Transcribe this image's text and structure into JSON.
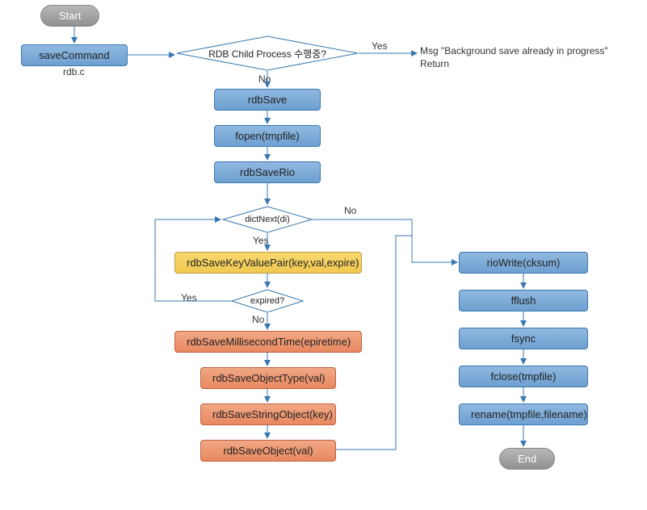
{
  "nodes": {
    "start": "Start",
    "saveCommand": "saveCommand",
    "saveCommand_sub": "rdb.c",
    "decision1": "RDB Child Process 수행중?",
    "msg_yes_line1": "Msg \"Background save already in progress\"",
    "msg_yes_line2": "Return",
    "rdbSave": "rdbSave",
    "fopen": "fopen(tmpfile)",
    "rdbSaveRio": "rdbSaveRio",
    "dictNext": "dictNext(di)",
    "rdbSaveKVP": "rdbSaveKeyValuePair(key,val,expire)",
    "expired": "expired?",
    "rdbSaveMs": "rdbSaveMillisecondTime(epiretime)",
    "rdbSaveObjType": "rdbSaveObjectType(val)",
    "rdbSaveStrObj": "rdbSaveStringObject(key)",
    "rdbSaveObj": "rdbSaveObject(val)",
    "rioWrite": "rioWrite(cksum)",
    "fflush": "fflush",
    "fsync": "fsync",
    "fclose": "fclose(tmpfile)",
    "rename": "rename(tmpfile,filename)",
    "end": "End"
  },
  "labels": {
    "yes1": "Yes",
    "no1": "No",
    "yes2": "Yes",
    "no2": "No",
    "yes3": "Yes",
    "no3": "No"
  },
  "chart_data": {
    "type": "flowchart",
    "title": "Redis SAVE command flow",
    "nodes": [
      {
        "id": "start",
        "type": "terminal",
        "label": "Start"
      },
      {
        "id": "saveCommand",
        "type": "process",
        "label": "saveCommand",
        "note": "rdb.c"
      },
      {
        "id": "d1",
        "type": "decision",
        "label": "RDB Child Process 수행중?"
      },
      {
        "id": "msg",
        "type": "annotation",
        "label": "Msg \"Background save already in progress\" Return"
      },
      {
        "id": "rdbSave",
        "type": "process",
        "label": "rdbSave"
      },
      {
        "id": "fopen",
        "type": "process",
        "label": "fopen(tmpfile)"
      },
      {
        "id": "rdbSaveRio",
        "type": "process",
        "label": "rdbSaveRio"
      },
      {
        "id": "d2",
        "type": "decision",
        "label": "dictNext(di)"
      },
      {
        "id": "rdbSaveKVP",
        "type": "process",
        "label": "rdbSaveKeyValuePair(key,val,expire)"
      },
      {
        "id": "d3",
        "type": "decision",
        "label": "expired?"
      },
      {
        "id": "rdbSaveMs",
        "type": "process",
        "label": "rdbSaveMillisecondTime(epiretime)"
      },
      {
        "id": "rdbSaveObjType",
        "type": "process",
        "label": "rdbSaveObjectType(val)"
      },
      {
        "id": "rdbSaveStrObj",
        "type": "process",
        "label": "rdbSaveStringObject(key)"
      },
      {
        "id": "rdbSaveObj",
        "type": "process",
        "label": "rdbSaveObject(val)"
      },
      {
        "id": "rioWrite",
        "type": "process",
        "label": "rioWrite(cksum)"
      },
      {
        "id": "fflush",
        "type": "process",
        "label": "fflush"
      },
      {
        "id": "fsync",
        "type": "process",
        "label": "fsync"
      },
      {
        "id": "fclose",
        "type": "process",
        "label": "fclose(tmpfile)"
      },
      {
        "id": "rename",
        "type": "process",
        "label": "rename(tmpfile,filename)"
      },
      {
        "id": "end",
        "type": "terminal",
        "label": "End"
      }
    ],
    "edges": [
      {
        "from": "start",
        "to": "saveCommand"
      },
      {
        "from": "saveCommand",
        "to": "d1"
      },
      {
        "from": "d1",
        "to": "msg",
        "label": "Yes"
      },
      {
        "from": "d1",
        "to": "rdbSave",
        "label": "No"
      },
      {
        "from": "rdbSave",
        "to": "fopen"
      },
      {
        "from": "fopen",
        "to": "rdbSaveRio"
      },
      {
        "from": "rdbSaveRio",
        "to": "d2"
      },
      {
        "from": "d2",
        "to": "rdbSaveKVP",
        "label": "Yes"
      },
      {
        "from": "d2",
        "to": "rioWrite",
        "label": "No"
      },
      {
        "from": "rdbSaveKVP",
        "to": "d3"
      },
      {
        "from": "d3",
        "to": "d2",
        "label": "Yes"
      },
      {
        "from": "d3",
        "to": "rdbSaveMs",
        "label": "No"
      },
      {
        "from": "rdbSaveMs",
        "to": "rdbSaveObjType"
      },
      {
        "from": "rdbSaveObjType",
        "to": "rdbSaveStrObj"
      },
      {
        "from": "rdbSaveStrObj",
        "to": "rdbSaveObj"
      },
      {
        "from": "rdbSaveObj",
        "to": "d2"
      },
      {
        "from": "rioWrite",
        "to": "fflush"
      },
      {
        "from": "fflush",
        "to": "fsync"
      },
      {
        "from": "fsync",
        "to": "fclose"
      },
      {
        "from": "fclose",
        "to": "rename"
      },
      {
        "from": "rename",
        "to": "end"
      }
    ]
  }
}
